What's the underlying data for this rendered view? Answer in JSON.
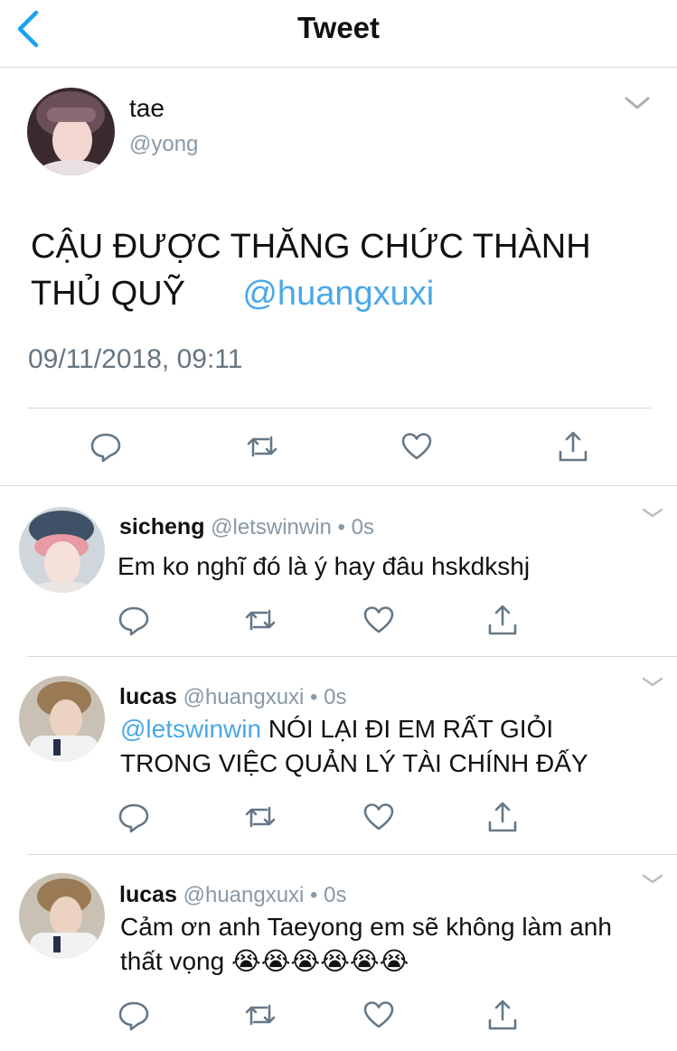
{
  "nav": {
    "title": "Tweet"
  },
  "main_tweet": {
    "name": "tae",
    "handle": "@yong",
    "text": "CẬU ĐƯỢC THĂNG CHỨC THÀNH THỦ QUỸ",
    "mention": "@huangxuxi",
    "timestamp": "09/11/2018, 09:11"
  },
  "replies": [
    {
      "name": "sicheng",
      "meta": "@letswinwin • 0s",
      "text": "Em ko nghĩ đó là ý hay đâu hskdkshj"
    },
    {
      "name": "lucas",
      "meta": "@huangxuxi • 0s",
      "mention": "@letswinwin",
      "text_line1": "NÓI LẠI ĐI EM RẤT GIỎI",
      "text_line2": "TRONG VIỆC QUẢN LÝ TÀI CHÍNH ĐẤY"
    },
    {
      "name": "lucas",
      "meta": "@huangxuxi • 0s",
      "text_line1": "Cảm ơn anh Taeyong em sẽ không làm anh",
      "text_line2": "thất vọng 😭😭😭😭😭😭"
    }
  ],
  "colors": {
    "accent": "#1da1f2",
    "mention": "#4aa8e8",
    "secondary_text": "#8899a6",
    "divider": "#d8d8d8"
  },
  "icons": [
    "back-chevron-icon",
    "dropdown-chevron-icon",
    "reply-icon",
    "retweet-icon",
    "like-icon",
    "share-icon"
  ]
}
